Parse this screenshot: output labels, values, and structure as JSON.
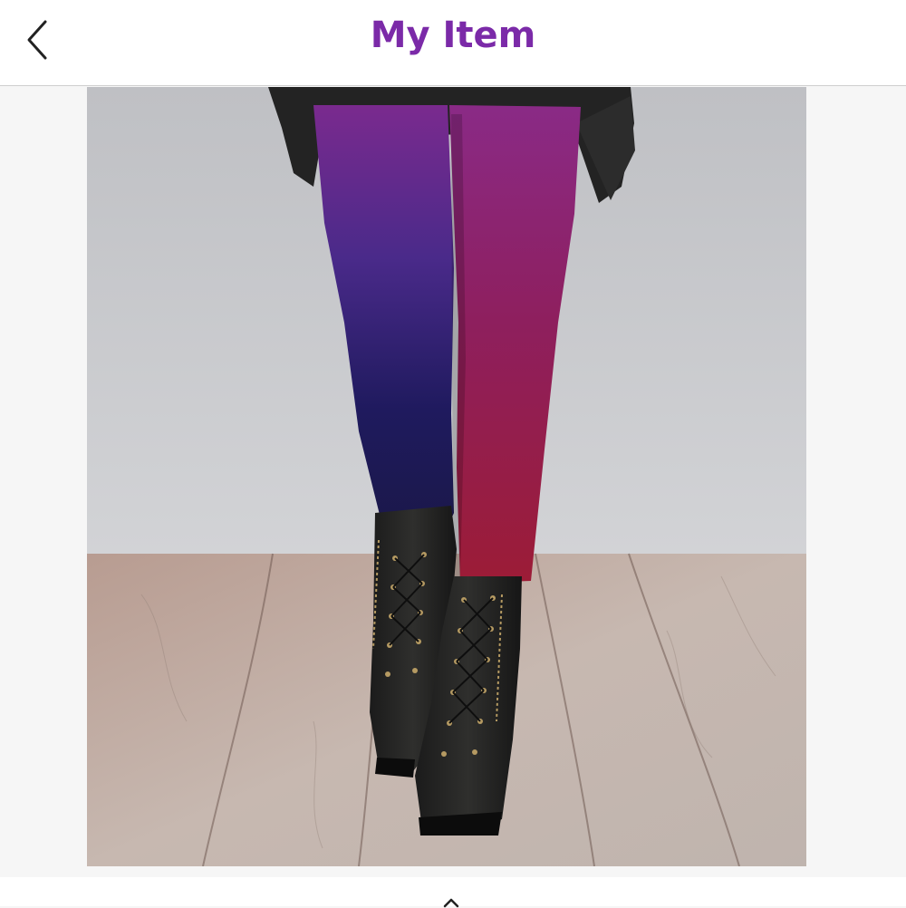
{
  "header": {
    "title": "My Item",
    "back_icon": "chevron-left-icon"
  },
  "colors": {
    "accent": "#7b2aa8",
    "header_bg": "#ffffff",
    "page_bg": "#f6f6f6",
    "divider": "#cfcfcf"
  },
  "item_photo": {
    "subject": "ombre-leggings-with-lace-up-boots"
  },
  "bottom_bar": {
    "icon": "share-icon"
  }
}
